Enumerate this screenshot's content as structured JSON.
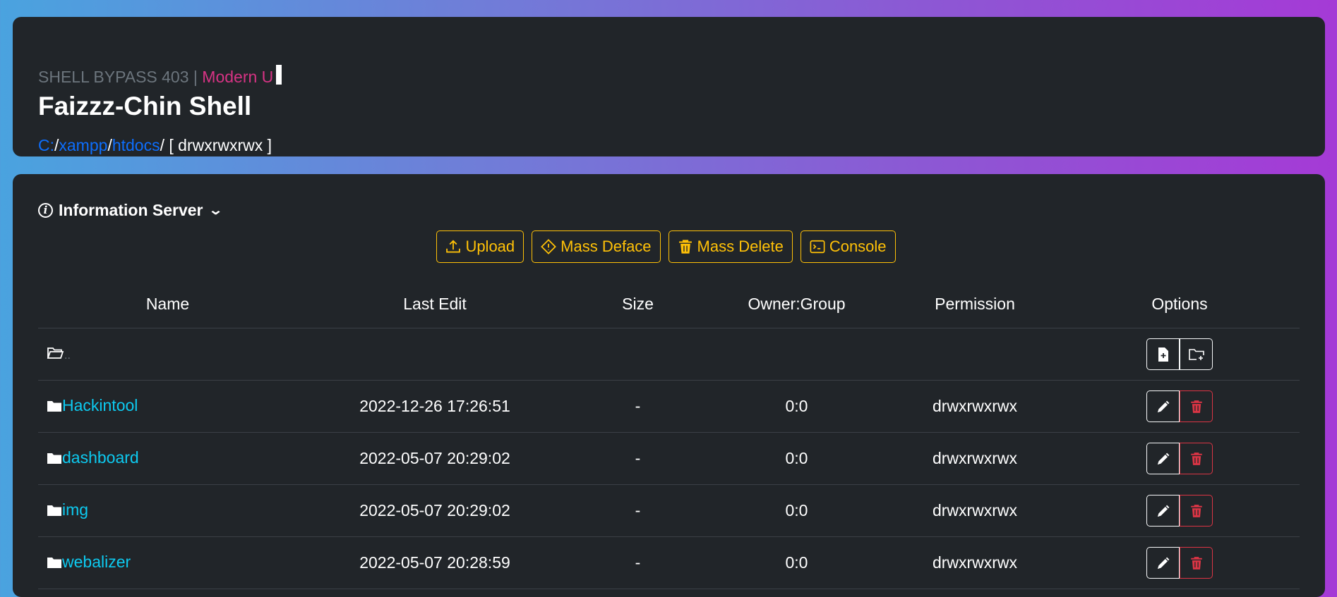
{
  "header": {
    "subtitle_prefix": "SHELL BYPASS 403 | ",
    "subtitle_accent": "Modern U",
    "title": "Faizzz-Chin Shell",
    "path": {
      "segments": [
        "C:",
        "xampp",
        "htdocs"
      ],
      "trailing": "/ [ drwxrwxrwx ]"
    }
  },
  "info": {
    "label": "Information Server",
    "icon": "info-circle-icon"
  },
  "actions": [
    {
      "label": "Upload",
      "icon": "upload-icon"
    },
    {
      "label": "Mass Deface",
      "icon": "diamond-icon"
    },
    {
      "label": "Mass Delete",
      "icon": "trash-icon"
    },
    {
      "label": "Console",
      "icon": "terminal-icon"
    }
  ],
  "table": {
    "headers": [
      "Name",
      "Last Edit",
      "Size",
      "Owner:Group",
      "Permission",
      "Options"
    ],
    "parent_label": "..",
    "rows": [
      {
        "name": "Hackintool",
        "last_edit": "2022-12-26 17:26:51",
        "size": "-",
        "owner": "0:0",
        "perm": "drwxrwxrwx"
      },
      {
        "name": "dashboard",
        "last_edit": "2022-05-07 20:29:02",
        "size": "-",
        "owner": "0:0",
        "perm": "drwxrwxrwx"
      },
      {
        "name": "img",
        "last_edit": "2022-05-07 20:29:02",
        "size": "-",
        "owner": "0:0",
        "perm": "drwxrwxrwx"
      },
      {
        "name": "webalizer",
        "last_edit": "2022-05-07 20:28:59",
        "size": "-",
        "owner": "0:0",
        "perm": "drwxrwxrwx"
      }
    ]
  },
  "colors": {
    "accent_pink": "#d63384",
    "link_blue": "#0d6efd",
    "folder_link": "#0dcaf0",
    "warning": "#ffc107",
    "danger": "#dc3545"
  }
}
